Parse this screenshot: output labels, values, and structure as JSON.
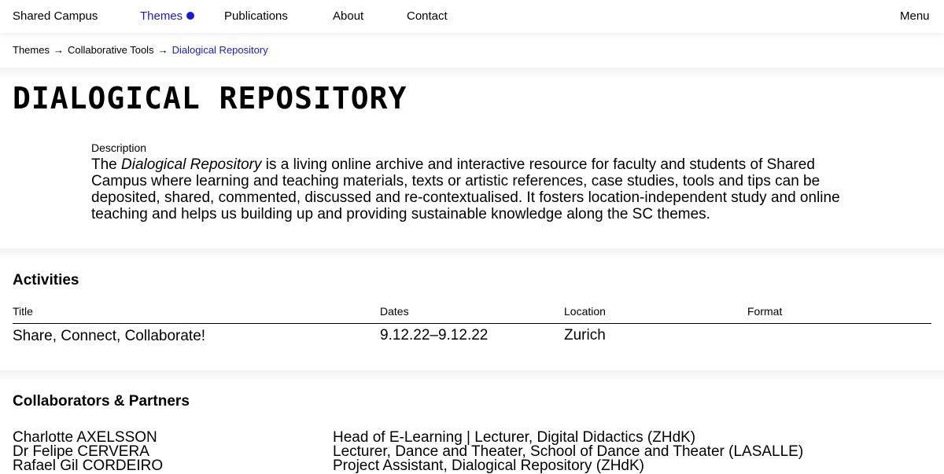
{
  "nav": {
    "brand": "Shared Campus",
    "items": [
      {
        "label": "Themes"
      },
      {
        "label": "Publications"
      },
      {
        "label": "About"
      },
      {
        "label": "Contact"
      }
    ],
    "menu": "Menu",
    "accent_color": "#1a1ad6"
  },
  "breadcrumb": {
    "items": [
      "Themes",
      "Collaborative Tools",
      "Dialogical Repository"
    ],
    "separator": "→"
  },
  "page": {
    "title": "DIALOGICAL REPOSITORY",
    "description_label": "Description",
    "description_prefix": "The ",
    "description_emphasis": "Dialogical Repository",
    "description_rest": " is a living online archive and interactive resource for faculty and students of Shared Campus where learning and teaching materials, texts or artistic references, case studies, tools and tips can be deposited, shared, commented, discussed and re-contextualised. It fosters location-independent study and online teaching and helps us building up and providing sustainable knowledge along the SC themes."
  },
  "activities": {
    "title": "Activities",
    "columns": [
      "Title",
      "Dates",
      "Location",
      "Format"
    ],
    "rows": [
      {
        "title": "Share, Connect, Collaborate!",
        "dates": "9.12.22–9.12.22",
        "location": "Zurich",
        "format": ""
      }
    ]
  },
  "collaborators": {
    "title": "Collaborators & Partners",
    "people": [
      {
        "name": "Charlotte AXELSSON",
        "role": "Head of E-Learning | Lecturer, Digital Didactics (ZHdK)"
      },
      {
        "name": "Dr Felipe CERVERA",
        "role": "Lecturer, Dance and Theater, School of Dance and Theater (LASALLE)"
      },
      {
        "name": "Rafael Gil CORDEIRO",
        "role": "Project Assistant, Dialogical Repository (ZHdK)"
      }
    ]
  }
}
